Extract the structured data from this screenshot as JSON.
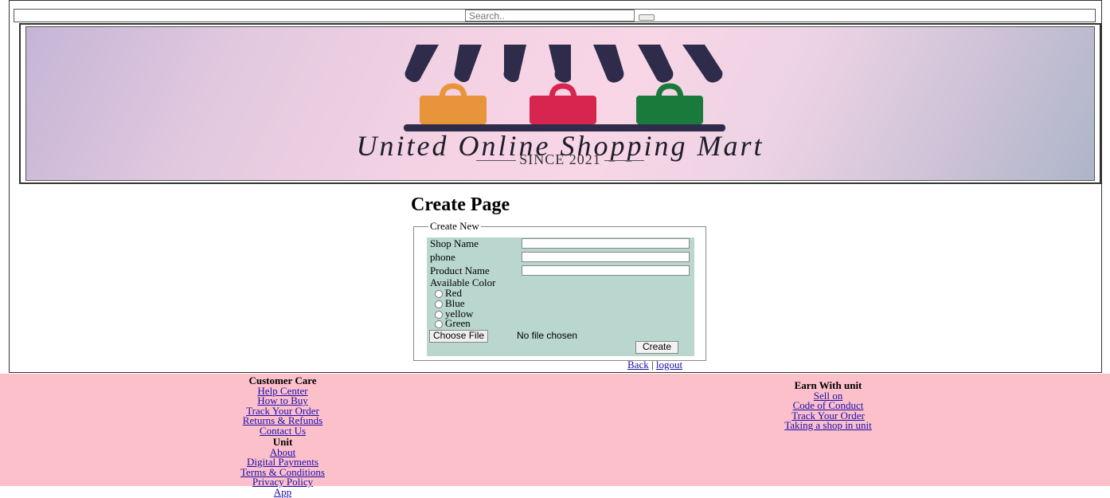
{
  "header": {
    "title_fragment": "pping"
  },
  "search": {
    "placeholder": "Search.."
  },
  "banner": {
    "brand": "United Online Shopping Mart",
    "since": "SINCE 2021"
  },
  "main": {
    "title": "Create Page"
  },
  "form": {
    "legend": "Create New",
    "shop_name_label": "Shop Name",
    "phone_label": "phone",
    "product_name_label": "Product Name",
    "color_label": "Available Color",
    "colors": [
      "Red",
      "Blue",
      "yellow",
      "Green"
    ],
    "file_button": "Choose File",
    "file_status": "No file chosen",
    "submit": "Create"
  },
  "nav": {
    "back": "Back",
    "separator": "|",
    "logout": "logout"
  },
  "footer": {
    "customer_care": {
      "heading": "Customer Care",
      "links": [
        "Help Center",
        "How to Buy",
        "Track Your Order",
        "Returns & Refunds",
        "Contact Us"
      ]
    },
    "unit": {
      "heading": "Unit",
      "links": [
        "About",
        "Digital Payments",
        "Terms & Conditions",
        "Privacy Policy",
        "App"
      ]
    },
    "earn": {
      "heading": "Earn With unit",
      "links": [
        "Sell on",
        "Code of Conduct",
        "Track Your Order",
        "Taking a shop in unit"
      ]
    }
  },
  "colors": {
    "title_red": "#e00000",
    "footer_bg": "#fcc0cb",
    "form_bg": "#b9d6cf",
    "link": "#1a0dab",
    "awning": "#2f2b4a",
    "bag_orange": "#e8943a",
    "bag_red": "#d6254f",
    "bag_green": "#1a7a3c"
  }
}
